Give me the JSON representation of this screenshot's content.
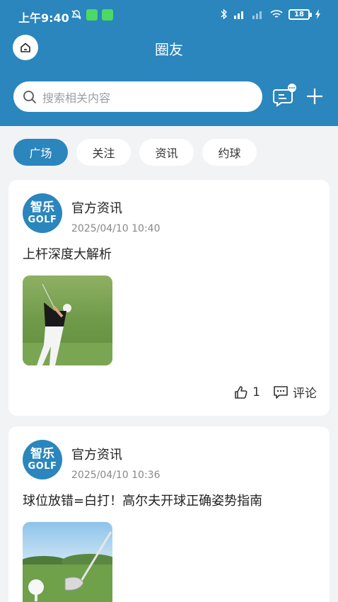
{
  "status_bar": {
    "time": "上午9:40",
    "battery": "18"
  },
  "header": {
    "title": "圈友",
    "search_placeholder": "搜索相关内容"
  },
  "tabs": [
    {
      "label": "广场",
      "active": true
    },
    {
      "label": "关注",
      "active": false
    },
    {
      "label": "资讯",
      "active": false
    },
    {
      "label": "约球",
      "active": false
    }
  ],
  "posts": [
    {
      "avatar_line1": "智乐",
      "avatar_line2": "GOLF",
      "author": "官方资讯",
      "time": "2025/04/10 10:40",
      "title": "上杆深度大解析",
      "likes": "1",
      "comment_label": "评论",
      "image_icon": "golfer-swing-photo"
    },
    {
      "avatar_line1": "智乐",
      "avatar_line2": "GOLF",
      "author": "官方资讯",
      "time": "2025/04/10 10:36",
      "title": "球位放错=白打！高尔夫开球正确姿势指南",
      "image_icon": "golf-ball-tee-photo"
    }
  ],
  "colors": {
    "brand": "#2a86bd",
    "page_bg": "#f2f3f5"
  }
}
